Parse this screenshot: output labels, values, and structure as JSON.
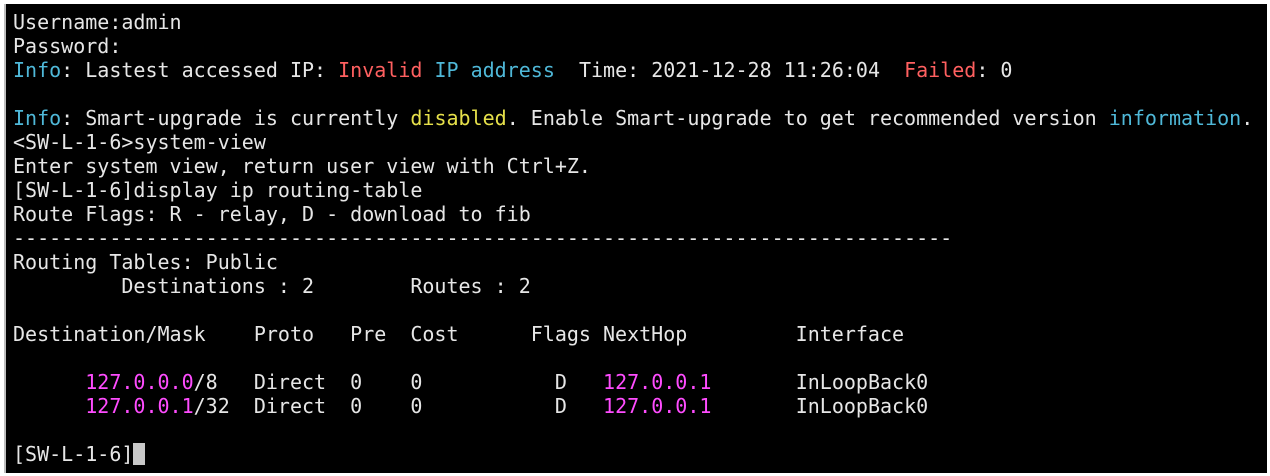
{
  "terminal": {
    "colors": {
      "background": "#000000",
      "text": "#e6e6e6",
      "info": "#4fb8d8",
      "error": "#ff6060",
      "warning": "#e6e04a",
      "address": "#ff4cff",
      "cursor": "#c8c8c8"
    },
    "lines": [
      [
        {
          "t": "Username:admin"
        }
      ],
      [
        {
          "t": "Password:"
        }
      ],
      [
        {
          "t": "Info",
          "c": "info"
        },
        {
          "t": ": Lastest accessed IP: "
        },
        {
          "t": "Invalid",
          "c": "error"
        },
        {
          "t": " "
        },
        {
          "t": "IP address",
          "c": "info"
        },
        {
          "t": "  Time: 2021-12-28 11:26:04  "
        },
        {
          "t": "Failed",
          "c": "error"
        },
        {
          "t": ": 0"
        }
      ],
      [],
      [
        {
          "t": "Info",
          "c": "info"
        },
        {
          "t": ": Smart-upgrade is currently "
        },
        {
          "t": "disabled",
          "c": "warning"
        },
        {
          "t": ". Enable Smart-upgrade to get recommended version "
        },
        {
          "t": "information",
          "c": "info"
        },
        {
          "t": "."
        }
      ],
      [
        {
          "t": "<SW-L-1-6>system-view"
        }
      ],
      [
        {
          "t": "Enter system view, return user view with Ctrl+Z."
        }
      ],
      [
        {
          "t": "[SW-L-1-6]display ip routing-table"
        }
      ],
      [
        {
          "t": "Route Flags: R - relay, D - download to fib"
        }
      ],
      [
        {
          "t": "------------------------------------------------------------------------------"
        }
      ],
      [
        {
          "t": "Routing Tables: Public"
        }
      ],
      [
        {
          "t": "         Destinations : 2        Routes : 2"
        }
      ],
      [],
      [
        {
          "t": "Destination/Mask    Proto   Pre  Cost      Flags NextHop         Interface"
        }
      ],
      [],
      [
        {
          "t": "      "
        },
        {
          "t": "127.0.0.0",
          "c": "address"
        },
        {
          "t": "/8   Direct  0    0           D   "
        },
        {
          "t": "127.0.0.1",
          "c": "address"
        },
        {
          "t": "       InLoopBack0"
        }
      ],
      [
        {
          "t": "      "
        },
        {
          "t": "127.0.0.1",
          "c": "address"
        },
        {
          "t": "/32  Direct  0    0           D   "
        },
        {
          "t": "127.0.0.1",
          "c": "address"
        },
        {
          "t": "       InLoopBack0"
        }
      ],
      [],
      [
        {
          "t": "[SW-L-1-6]"
        },
        {
          "cursor": true
        }
      ]
    ]
  }
}
